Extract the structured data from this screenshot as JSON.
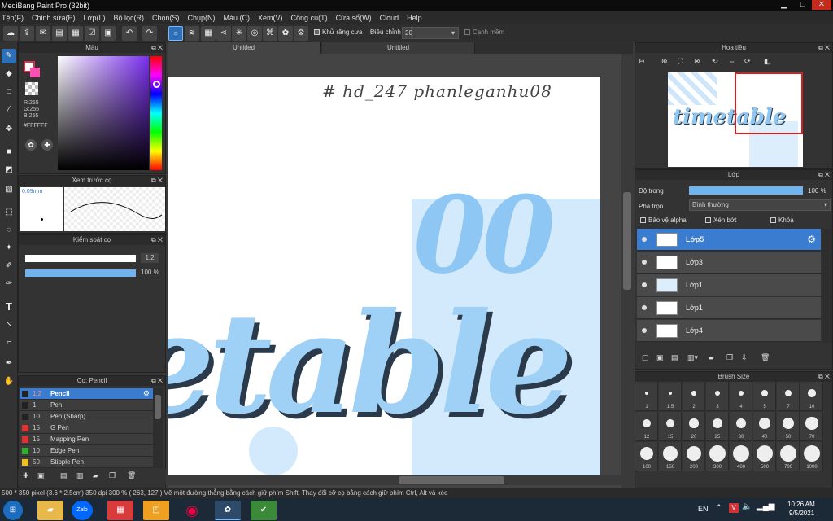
{
  "titlebar": {
    "title": "MediBang Paint Pro (32bit)"
  },
  "menu": [
    "Tệp(F)",
    "Chỉnh sửa(E)",
    "Lớp(L)",
    "Bộ lọc(R)",
    "Chọn(S)",
    "Chụp(N)",
    "Màu (C)",
    "Xem(V)",
    "Công cụ(T)",
    "Cửa sổ(W)",
    "Cloud",
    "Help"
  ],
  "toolbar": {
    "antialias_label": "Khử răng cưa",
    "adjust_label": "Điều chỉnh",
    "adjust_value": "20",
    "snap_label": "Cạnh mềm"
  },
  "color_panel": {
    "title": "Màu",
    "r": "R:255",
    "g": "G:255",
    "b": "B:255",
    "hex": "#FFFFFF"
  },
  "brush_preview": {
    "title": "Xem trước cọ",
    "size": "0.09mm"
  },
  "brush_control": {
    "title": "Kiểm soát cọ",
    "size_value": "1.2",
    "opacity_value": "100 %"
  },
  "brush_list": {
    "title": "Cọ: Pencil",
    "items": [
      {
        "size": "1.2",
        "name": "Pencil",
        "color": "#222222"
      },
      {
        "size": "1",
        "name": "Pen",
        "color": "#222222"
      },
      {
        "size": "10",
        "name": "Pen (Sharp)",
        "color": "#222222"
      },
      {
        "size": "15",
        "name": "G Pen",
        "color": "#e03030"
      },
      {
        "size": "15",
        "name": "Mapping Pen",
        "color": "#e03030"
      },
      {
        "size": "10",
        "name": "Edge Pen",
        "color": "#30b030"
      },
      {
        "size": "50",
        "name": "Stipple Pen",
        "color": "#f0c020"
      }
    ]
  },
  "tabs": [
    "Untitled",
    "Untitled"
  ],
  "canvas": {
    "handwriting": "# hd_247 phanleganhu08",
    "word_top": "00",
    "word_main": "etable",
    "preview_word": "timetable"
  },
  "navigator": {
    "title": "Hoa tiêu"
  },
  "layers": {
    "title": "Lớp",
    "opacity_label": "Độ trong",
    "opacity_value": "100 %",
    "blend_label": "Pha trộn",
    "blend_value": "Bình thường",
    "protect_alpha": "Bảo vệ alpha",
    "clip": "Xén bớt",
    "lock": "Khóa",
    "items": [
      "Lớp5",
      "Lớp3",
      "Lớp1",
      "Lớp1",
      "Lớp4"
    ]
  },
  "brush_size": {
    "title": "Brush Size",
    "sizes": [
      "1",
      "1.5",
      "2",
      "3",
      "4",
      "5",
      "7",
      "10",
      "12",
      "15",
      "20",
      "25",
      "30",
      "40",
      "50",
      "70",
      "100",
      "150",
      "200",
      "300",
      "400",
      "500",
      "700",
      "1000"
    ]
  },
  "statusbar": {
    "text": "500 * 350 pixel   (3.6 * 2.5cm)   350 dpi   300 %   ( 263, 127 )   Vẽ một đường thẳng bằng cách giữ phím Shift, Thay đổi cỡ cọ bằng cách giữ phím Ctrl, Alt và kéo"
  },
  "taskbar": {
    "lang": "EN",
    "time": "10:26 AM",
    "date": "9/5/2021",
    "zalo": "Zalo"
  },
  "colors": {
    "accent": "#2d6fb8",
    "paint": "#8ec7f3",
    "paint_dark": "#2b3a4a"
  }
}
